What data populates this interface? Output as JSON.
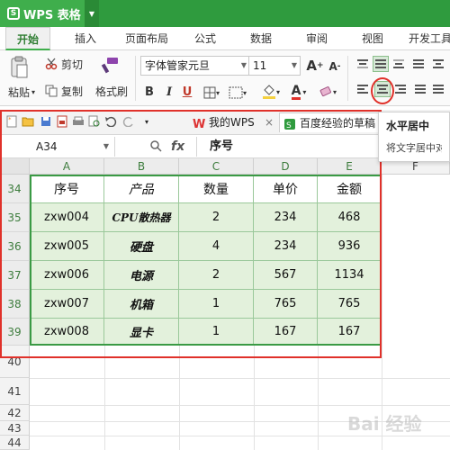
{
  "app": {
    "title": "WPS 表格",
    "logo_glyph": "S"
  },
  "ribbon_tabs": [
    "开始",
    "插入",
    "页面布局",
    "公式",
    "数据",
    "审阅",
    "视图",
    "开发工具"
  ],
  "ribbon": {
    "cut_label": "剪切",
    "paste_label": "粘贴",
    "copy_label": "复制",
    "format_painter_label": "格式刷",
    "font_name": "字体管家元旦",
    "font_size": "11",
    "grow_label": "A",
    "shrink_label": "A",
    "bold_label": "B",
    "italic_label": "I",
    "underline_label": "U",
    "font_color_label": "A",
    "accent": "#2f9b3e"
  },
  "doc_tabs": [
    {
      "label": "我的WPS"
    },
    {
      "label": "百度经验的草稿"
    }
  ],
  "tooltip": {
    "title": "水平居中",
    "description": "将文字居中对齐"
  },
  "formula_bar": {
    "cell_ref": "A34",
    "fx": "fx",
    "content": "序号"
  },
  "columns": [
    "A",
    "B",
    "C",
    "D",
    "E",
    "F"
  ],
  "rows": [
    "34",
    "35",
    "36",
    "37",
    "38",
    "39",
    "40",
    "41",
    "42",
    "43",
    "44"
  ],
  "table": {
    "headers": [
      "序号",
      "产品",
      "数量",
      "单价",
      "金额"
    ],
    "rows": [
      [
        "zxw004",
        "CPU散热器",
        "2",
        "234",
        "468"
      ],
      [
        "zxw005",
        "硬盘",
        "4",
        "234",
        "936"
      ],
      [
        "zxw006",
        "电源",
        "2",
        "567",
        "1134"
      ],
      [
        "zxw007",
        "机箱",
        "1",
        "765",
        "765"
      ],
      [
        "zxw008",
        "显卡",
        "1",
        "167",
        "167"
      ]
    ]
  },
  "watermark": "Bai 经验"
}
